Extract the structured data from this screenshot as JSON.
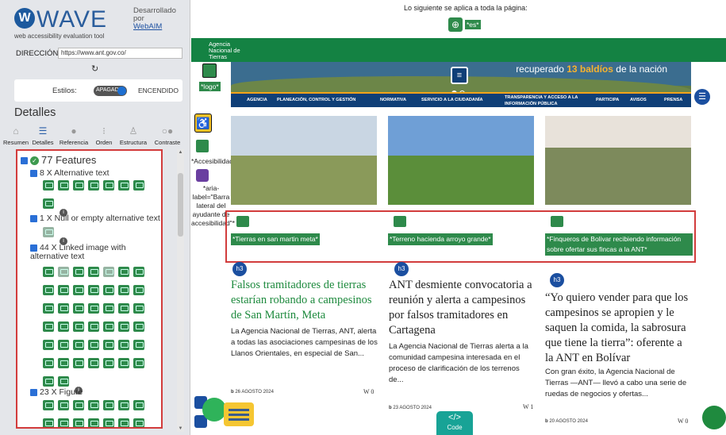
{
  "sidebar": {
    "logo_text": "WAVE",
    "tagline": "web accessibility evaluation tool",
    "developed_by": "Desarrollado por",
    "webaim_link": "WebAIM",
    "address_label": "DIRECCIÓN:",
    "address_value": "https://www.ant.gov.co/",
    "refresh_icon": "refresh-icon",
    "styles_label": "Estilos:",
    "styles_off": "APAGADO",
    "styles_on": "ENCENDIDO",
    "details_title": "Detalles",
    "tabs": [
      {
        "label": "Resumen",
        "icon": "home-icon"
      },
      {
        "label": "Detalles",
        "icon": "list-icon"
      },
      {
        "label": "Referencia",
        "icon": "info-icon"
      },
      {
        "label": "Orden",
        "icon": "order-icon"
      },
      {
        "label": "Estructura",
        "icon": "structure-icon"
      },
      {
        "label": "Contraste",
        "icon": "contrast-icon"
      }
    ],
    "features_header": "77 Features",
    "categories": [
      {
        "label": "8 X Alternative text"
      },
      {
        "label": "1 X Null or empty alternative text"
      },
      {
        "label": "44 X Linked image with alternative text"
      },
      {
        "label": "23 X Figure"
      }
    ]
  },
  "page": {
    "note": "Lo siguiente se aplica a toda la página:",
    "lang_tag": "*es*",
    "agency_name": [
      "Agencia",
      "Nacional de",
      "Tierras"
    ],
    "logo_tag": "*logo*",
    "hero_text_before": "recuperado",
    "hero_text_emphasis": "13 baldíos",
    "hero_text_after": "de la nación",
    "nav": [
      "AGENCIA",
      "PLANEACIÓN, CONTROL Y GESTIÓN",
      "NORMATIVA",
      "SERVICIO A LA CIUDADANÍA",
      "TRANSPARENCIA Y ACCESO A LA INFORMACIÓN PÚBLICA",
      "PARTICIPA",
      "AVISOS",
      "PRENSA"
    ],
    "accessibility_tag": "*Accesibilidad*",
    "aria_tag": "*aria-label=\"Barra lateral del ayudante de accesibilidad\"*",
    "h3_label": "h3",
    "code_label": "Code",
    "articles": [
      {
        "fig_tag": "*Tierras en san martin meta*",
        "headline": "Falsos tramitadores de tierras estarían robando a campesinos de San Martín, Meta",
        "body": "La Agencia Nacional de Tierras, ANT, alerta a todas las asociaciones campesinas de los Llanos Orientales, en especial de San...",
        "date": "26 AGOSTO 2024",
        "views": "0"
      },
      {
        "fig_tag": "*Terreno hacienda arroyo grande*",
        "headline": "ANT desmiente convocatoria a reunión y alerta a campesinos por falsos tramitadores en Cartagena",
        "body": "La Agencia Nacional de Tierras alerta a la comunidad campesina interesada en el proceso de clarificación de los terrenos de...",
        "date": "23 AGOSTO 2024",
        "views": "1"
      },
      {
        "fig_tag": "*Finqueros de Bolivar recibiendo información sobre ofertar sus fincas a la ANT*",
        "headline": "“Yo quiero vender para que los campesinos se apropien y le saquen la comida, la sabrosura que tiene la tierra”: oferente a la ANT en Bolívar",
        "body": "Con gran éxito, la Agencia Nacional de Tierras —ANT— llevó a cabo una serie de ruedas de negocios y ofertas...",
        "date": "20 AGOSTO 2024",
        "views": "0"
      }
    ]
  }
}
